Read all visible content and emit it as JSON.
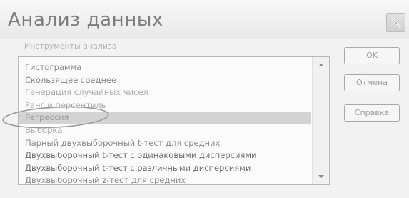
{
  "dialog": {
    "title": "Анализ данных",
    "group_label": "Инструменты анализа"
  },
  "tools": [
    {
      "label": "Гистограмма"
    },
    {
      "label": "Скользящее среднее"
    },
    {
      "label": "Генерация случайных чисел"
    },
    {
      "label": "Ранг и персентиль"
    },
    {
      "label": "Регрессия"
    },
    {
      "label": "Выборка"
    },
    {
      "label": "Парный двухвыборочный t-тест для средних"
    },
    {
      "label": "Двухвыборочный t-тест с одинаковыми дисперсиями"
    },
    {
      "label": "Двухвыборочный t-тест с различными дисперсиями"
    },
    {
      "label": "Двухвыборочный z-тест для средних"
    }
  ],
  "selected_tool": "Регрессия",
  "buttons": {
    "ok": "OK",
    "cancel": "Отмена",
    "help": "Справка"
  },
  "icons": {
    "close": "close-icon",
    "scroll_up": "scroll-up-arrow-icon",
    "scroll_down": "scroll-down-arrow-icon"
  },
  "colors": {
    "selection": "#d3d3d3",
    "annotation_circle": "#9a9a9a"
  }
}
